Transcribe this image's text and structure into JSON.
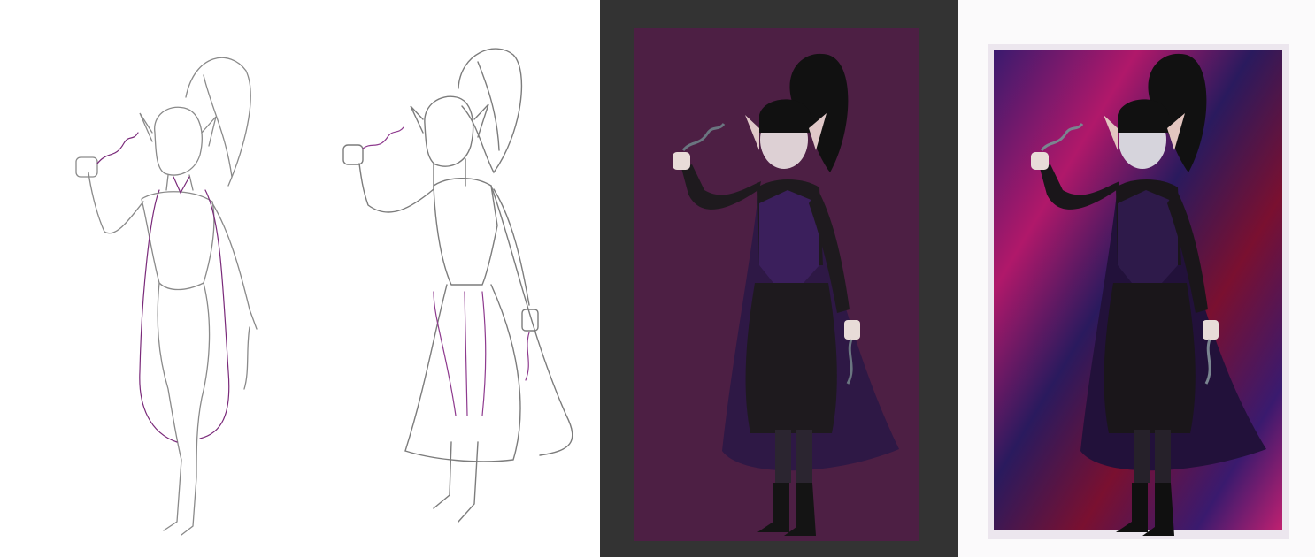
{
  "title": "",
  "panels": [
    {
      "id": "rough-sketch",
      "background": "#ffffff",
      "line_colors": [
        "#8a8a8a",
        "#7a2a7a"
      ]
    },
    {
      "id": "clean-lineart",
      "background": "#ffffff",
      "line_colors": [
        "#7c7c7c",
        "#8e3a8e"
      ]
    },
    {
      "id": "flat-colors",
      "background": "#333333",
      "canvas_color": "#4d1f44"
    },
    {
      "id": "final-render",
      "background": "#fbfafb",
      "gradient_colors": [
        "#3a1a6e",
        "#b0186a",
        "#7a1030",
        "#2a1a5e",
        "#c02070"
      ]
    }
  ],
  "character": {
    "skin": "#e8dcd8",
    "hair": "#111111",
    "dress": "#1e1a1e",
    "vest": "#3b1f5c",
    "eyes": "#c77a1a",
    "magic": "#6a7580"
  }
}
